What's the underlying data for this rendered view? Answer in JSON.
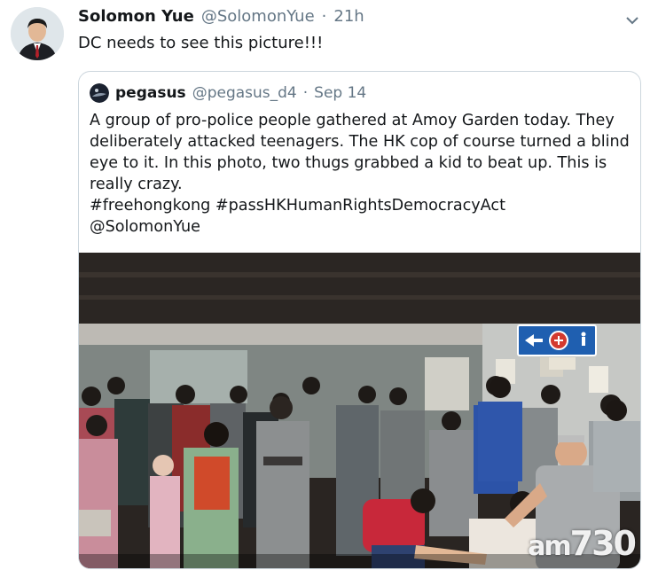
{
  "tweet": {
    "display_name": "Solomon Yue",
    "handle": "@SolomonYue",
    "separator": "·",
    "time": "21h",
    "text": "DC needs to see this picture!!!"
  },
  "quote": {
    "display_name": "pegasus",
    "handle": "@pegasus_d4",
    "separator": "·",
    "time": "Sep 14",
    "lines": [
      "A group of pro-police people gathered at Amoy Garden today. They",
      "deliberately attacked teenagers. The HK cop of course turned a blind",
      "eye to it. In this photo, two thugs grabbed a kid to beat up. This is",
      "really crazy.",
      "#freehongkong #passHKHumanRightsDemocracyAct",
      "@SolomonYue"
    ],
    "image": {
      "description_icon": "photo-icon",
      "watermark_prefix": "am",
      "watermark_number": "730"
    }
  },
  "colors": {
    "text_primary": "#14171a",
    "text_secondary": "#657786",
    "border": "#ccd6dd",
    "sign_blue": "#1f5fb0"
  }
}
